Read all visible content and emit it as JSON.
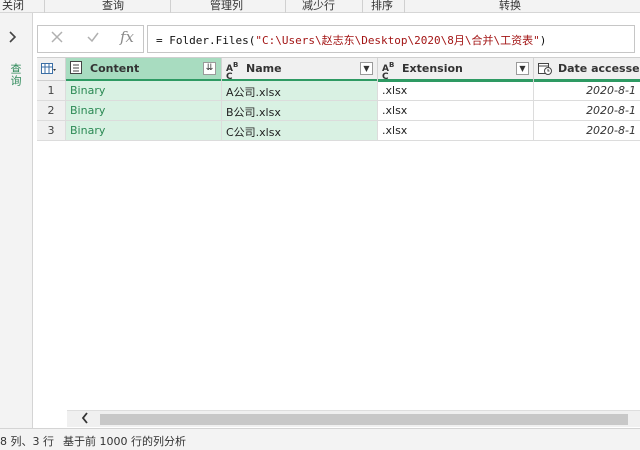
{
  "ribbon": {
    "groups": [
      "关闭",
      "查询",
      "管理列",
      "减少行",
      "排序",
      "转换"
    ]
  },
  "query_pane": {
    "label": "查询",
    "expand_icon": "chevron-right-icon"
  },
  "formula_bar": {
    "cancel_icon": "close-icon",
    "commit_icon": "check-icon",
    "fx_label": "fx",
    "prefix": "= Folder.Files(",
    "path": "\"C:\\Users\\赵志东\\Desktop\\2020\\8月\\合并\\工资表\"",
    "suffix": ")"
  },
  "grid": {
    "columns": [
      {
        "name": "Content",
        "type_icon": "table-icon",
        "selected": true
      },
      {
        "name": "Name",
        "type_icon": "text-type-icon",
        "selected": false
      },
      {
        "name": "Extension",
        "type_icon": "text-type-icon",
        "selected": false
      },
      {
        "name": "Date accessed",
        "type_icon": "datetime-type-icon",
        "selected": false
      }
    ],
    "rows": [
      {
        "num": "1",
        "content": "Binary",
        "name": "A公司.xlsx",
        "extension": ".xlsx",
        "date_accessed": "2020-8-1"
      },
      {
        "num": "2",
        "content": "Binary",
        "name": "B公司.xlsx",
        "extension": ".xlsx",
        "date_accessed": "2020-8-1"
      },
      {
        "num": "3",
        "content": "Binary",
        "name": "C公司.xlsx",
        "extension": ".xlsx",
        "date_accessed": "2020-8-1"
      }
    ]
  },
  "status": {
    "counts": "8 列、3 行",
    "profile": "基于前 1000 行的列分析"
  },
  "colors": {
    "accent": "#2e9a63",
    "selected_header": "#a8dcc0",
    "selected_cell": "#d9f1e3",
    "binary_text": "#2c8a55",
    "string_literal": "#a31515"
  }
}
